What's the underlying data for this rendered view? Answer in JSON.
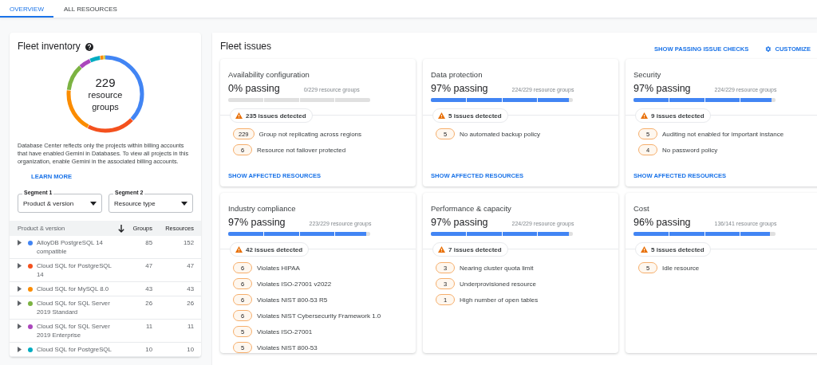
{
  "tabs": [
    {
      "label": "OVERVIEW",
      "selected": true
    },
    {
      "label": "ALL RESOURCES",
      "selected": false
    }
  ],
  "inventory": {
    "title": "Fleet inventory",
    "total": "229",
    "total_label": "resource groups",
    "note": "Database Center reflects only the projects within billing accounts that have enabled Gemini in Databases. To view all projects in this organization, enable Gemini in the associated billing accounts.",
    "link": "LEARN MORE",
    "segments": [
      {
        "label": "Segment 1",
        "value": "Product & version"
      },
      {
        "label": "Segment 2",
        "value": "Resource type"
      }
    ],
    "table": {
      "columns": [
        "Product & version",
        "Groups",
        "Resources"
      ],
      "rows": [
        {
          "name": "AlloyDB PostgreSQL 14 compatible",
          "color": "#4285f4",
          "groups": "85",
          "resources": "152"
        },
        {
          "name": "Cloud SQL for PostgreSQL 14",
          "color": "#f4511e",
          "groups": "47",
          "resources": "47"
        },
        {
          "name": "Cloud SQL for MySQL 8.0",
          "color": "#fb8c00",
          "groups": "43",
          "resources": "43"
        },
        {
          "name": "Cloud SQL for SQL Server 2019 Standard",
          "color": "#7cb342",
          "groups": "26",
          "resources": "26"
        },
        {
          "name": "Cloud SQL for SQL Server 2019 Enterprise",
          "color": "#ab47bc",
          "groups": "11",
          "resources": "11"
        },
        {
          "name": "Cloud SQL for PostgreSQL",
          "color": "#00acc1",
          "groups": "10",
          "resources": "10"
        }
      ]
    }
  },
  "issues": {
    "title": "Fleet issues",
    "actions": [
      "SHOW PASSING ISSUE CHECKS",
      "CUSTOMIZE"
    ],
    "cards": [
      {
        "title": "Availability configuration",
        "passing": "0% passing",
        "count": "0/229 resource groups",
        "level": 0,
        "detected": "235 issues detected",
        "items": [
          {
            "n": "229",
            "text": "Group not replicating across regions"
          },
          {
            "n": "6",
            "text": "Resource not failover protected"
          }
        ],
        "link": "SHOW AFFECTED RESOURCES"
      },
      {
        "title": "Data protection",
        "passing": "97% passing",
        "count": "224/229 resource groups",
        "level": 0.97,
        "detected": "5 issues detected",
        "items": [
          {
            "n": "5",
            "text": "No automated backup policy"
          }
        ],
        "link": "SHOW AFFECTED RESOURCES"
      },
      {
        "title": "Security",
        "passing": "97% passing",
        "count": "224/229 resource groups",
        "level": 0.97,
        "detected": "9 issues detected",
        "items": [
          {
            "n": "5",
            "text": "Auditing not enabled for important instance"
          },
          {
            "n": "4",
            "text": "No password policy"
          }
        ],
        "link": "SHOW AFFECTED RESOURCES"
      },
      {
        "title": "Industry compliance",
        "passing": "97% passing",
        "count": "223/229 resource groups",
        "level": 0.97,
        "detected": "42 issues detected",
        "items": [
          {
            "n": "6",
            "text": "Violates HIPAA"
          },
          {
            "n": "6",
            "text": "Violates ISO-27001 v2022"
          },
          {
            "n": "6",
            "text": "Violates NIST 800-53 R5"
          },
          {
            "n": "6",
            "text": "Violates NIST Cybersecurity Framework 1.0"
          },
          {
            "n": "5",
            "text": "Violates ISO-27001"
          },
          {
            "n": "5",
            "text": "Violates NIST 800-53"
          }
        ]
      },
      {
        "title": "Performance & capacity",
        "passing": "97% passing",
        "count": "224/229 resource groups",
        "level": 0.97,
        "detected": "7 issues detected",
        "items": [
          {
            "n": "3",
            "text": "Nearing cluster quota limit"
          },
          {
            "n": "3",
            "text": "Underprovisioned resource"
          },
          {
            "n": "1",
            "text": "High number of open tables"
          }
        ]
      },
      {
        "title": "Cost",
        "passing": "96% passing",
        "count": "136/141 resource groups",
        "level": 0.96,
        "detected": "5 issues detected",
        "items": [
          {
            "n": "5",
            "text": "Idle resource"
          }
        ]
      }
    ]
  }
}
